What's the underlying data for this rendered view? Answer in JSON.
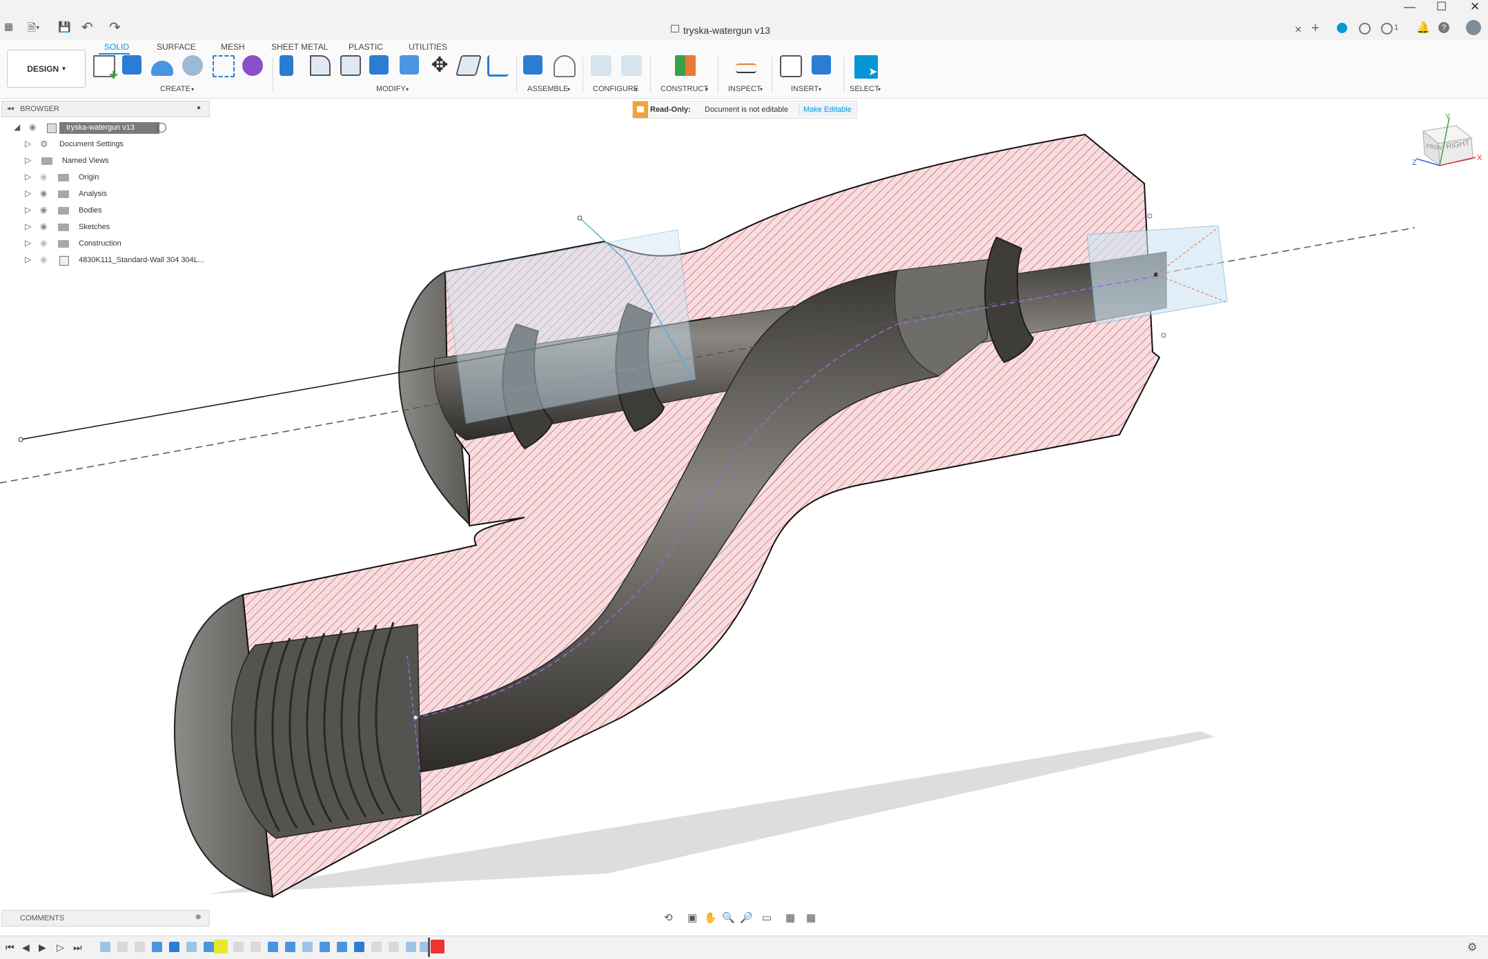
{
  "window": {
    "title": "tryska-watergun v13",
    "close_tab": "×",
    "controls": [
      "—",
      "☐",
      "✕"
    ]
  },
  "toolbar_top": {
    "undo": "↶",
    "redo": "↷",
    "notifications_count": "1"
  },
  "workspace": {
    "label": "DESIGN",
    "tabs": [
      "SOLID",
      "SURFACE",
      "MESH",
      "SHEET METAL",
      "PLASTIC",
      "UTILITIES"
    ],
    "active_tab": "SOLID"
  },
  "tool_groups": [
    "CREATE",
    "MODIFY",
    "ASSEMBLE",
    "CONFIGURE",
    "CONSTRUCT",
    "INSPECT",
    "INSERT",
    "SELECT"
  ],
  "browser": {
    "title": "BROWSER",
    "root": "tryska-watergun v13",
    "items": [
      {
        "label": "Document Settings"
      },
      {
        "label": "Named Views"
      },
      {
        "label": "Origin"
      },
      {
        "label": "Analysis"
      },
      {
        "label": "Bodies"
      },
      {
        "label": "Sketches"
      },
      {
        "label": "Construction"
      },
      {
        "label": "4830K111_Standard-Wall 304 304L..."
      }
    ]
  },
  "readonly_banner": {
    "label": "Read-Only:",
    "message": "Document is not editable",
    "action": "Make Editable"
  },
  "viewcube": {
    "front": "FRONT",
    "right": "RIGHT",
    "axis_x": "X",
    "axis_y": "Y",
    "axis_z": "Z"
  },
  "comments": {
    "title": "COMMENTS"
  },
  "colors": {
    "accent": "#0696d7",
    "section_fill": "#f6dde0",
    "hatch": "#c2262f",
    "body_dark": "#4a4845",
    "readonly_lock": "#f2a33a"
  }
}
